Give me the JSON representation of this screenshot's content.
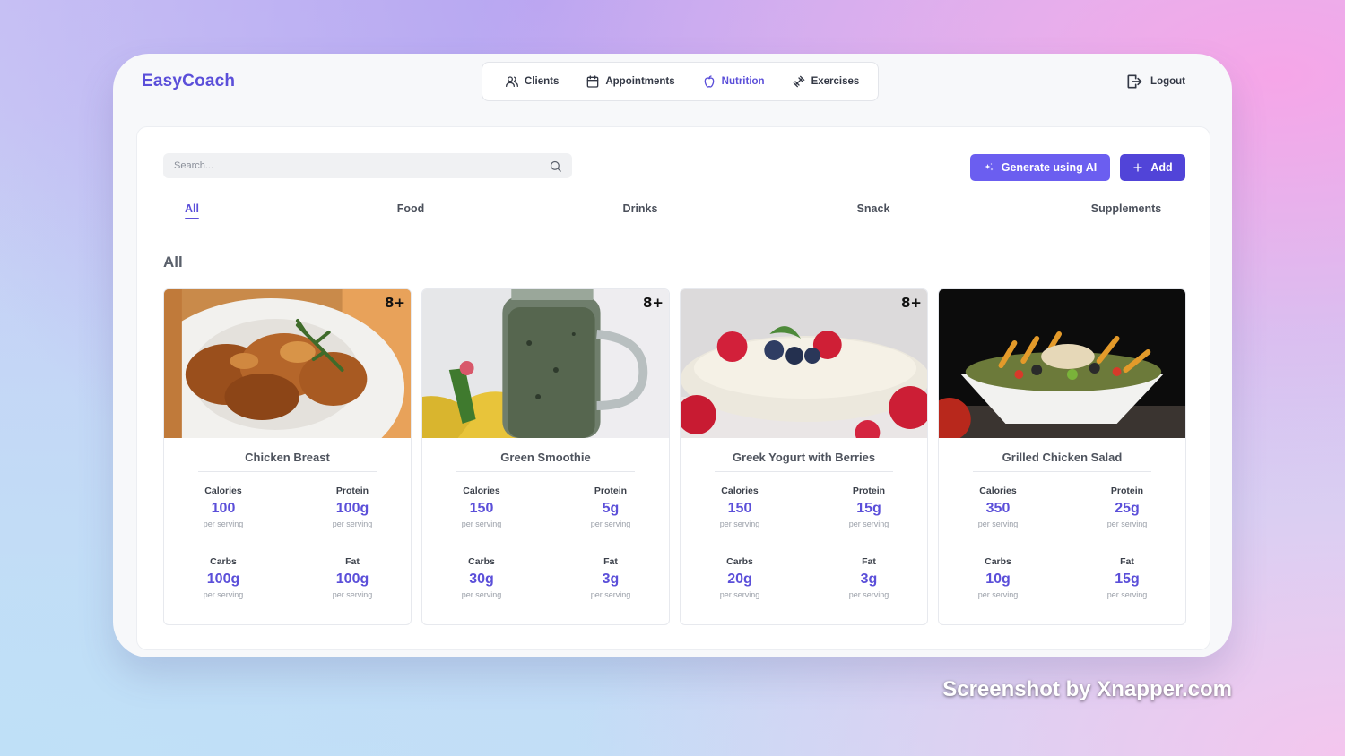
{
  "app": {
    "name": "EasyCoach"
  },
  "nav": {
    "items": [
      {
        "label": "Clients",
        "icon": "users-icon",
        "active": false
      },
      {
        "label": "Appointments",
        "icon": "calendar-icon",
        "active": false
      },
      {
        "label": "Nutrition",
        "icon": "apple-icon",
        "active": true
      },
      {
        "label": "Exercises",
        "icon": "dumbbell-icon",
        "active": false
      }
    ],
    "logout": "Logout"
  },
  "search": {
    "placeholder": "Search...",
    "value": ""
  },
  "actions": {
    "generate_ai": "Generate using AI",
    "add": "Add"
  },
  "tabs": [
    {
      "label": "All",
      "active": true
    },
    {
      "label": "Food",
      "active": false
    },
    {
      "label": "Drinks",
      "active": false
    },
    {
      "label": "Snack",
      "active": false
    },
    {
      "label": "Supplements",
      "active": false
    }
  ],
  "section_title": "All",
  "stat_labels": {
    "calories": "Calories",
    "protein": "Protein",
    "carbs": "Carbs",
    "fat": "Fat",
    "unit": "per serving"
  },
  "cards": [
    {
      "title": "Chicken Breast",
      "badge": "8+",
      "image": "roasted-chicken-photo",
      "calories": "100",
      "protein": "100g",
      "carbs": "100g",
      "fat": "100g"
    },
    {
      "title": "Green Smoothie",
      "badge": "8+",
      "image": "green-smoothie-jar-photo",
      "calories": "150",
      "protein": "5g",
      "carbs": "30g",
      "fat": "3g"
    },
    {
      "title": "Greek Yogurt with Berries",
      "badge": "8+",
      "image": "yogurt-berries-photo",
      "calories": "150",
      "protein": "15g",
      "carbs": "20g",
      "fat": "3g"
    },
    {
      "title": "Grilled Chicken Salad",
      "badge": "",
      "image": "chicken-salad-photo",
      "calories": "350",
      "protein": "25g",
      "carbs": "10g",
      "fat": "15g"
    }
  ],
  "watermark": "Screenshot by Xnapper.com",
  "colors": {
    "accent": "#5b4fd9",
    "ai_button": "#6b5ef0",
    "add_button": "#5144d8"
  }
}
